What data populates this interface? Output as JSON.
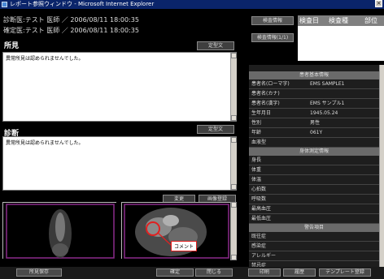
{
  "window": {
    "title": "レポート参照ウィンドウ - Microsoft Internet Explorer"
  },
  "left": {
    "line_top": "診断医:テスト 医師 ／ 2006/08/11 18:00:35",
    "diagnosis_doctor": "診断医:テスト 医師 ／ 2006/08/11 18:00:35",
    "confirm_doctor": "確定医:テスト 医師 ／ 2006/08/11 18:00:35",
    "findings_label": "所見",
    "findings_btn": "定型文",
    "findings_text": "異常所見は認められませんでした。",
    "diagnosis_label": "診断",
    "diagnosis_btn": "定型文",
    "diagnosis_text": "異常所見は認められませんでした。",
    "btn_edit": "変更",
    "btn_image_register": "画像登録",
    "annotation": "コメント"
  },
  "right": {
    "exam_info_btn": "検査情報",
    "exam_info_btn2": "検査情報(1/1)",
    "col_date": "検査日",
    "col_type": "検査種",
    "col_part": "部位",
    "patient_header": "患者基本情報",
    "patient_rows": [
      {
        "label": "患者名(ローマ字)",
        "value": "EMS SAMPLE1"
      },
      {
        "label": "患者名(カナ)",
        "value": ""
      },
      {
        "label": "患者名(漢字)",
        "value": "EMS サンプル1"
      },
      {
        "label": "生年月日",
        "value": "1945.05.24"
      },
      {
        "label": "性別",
        "value": "男性"
      },
      {
        "label": "年齢",
        "value": "061Y"
      },
      {
        "label": "血液型",
        "value": ""
      }
    ],
    "body_header": "身体測定情報",
    "body_rows": [
      "身長",
      "体重",
      "体温",
      "心拍数",
      "呼吸数",
      "最高血圧",
      "最低血圧"
    ],
    "caution_header": "警告項目",
    "caution_rows": [
      "既往症",
      "感染症",
      "アレルギー",
      "禁忌症",
      "特記事項"
    ]
  },
  "footer": {
    "btn_save": "所見保存",
    "btn_confirm": "確定",
    "btn_close": "閉じる",
    "btn_print": "印刷",
    "btn_history": "履歴",
    "btn_template": "テンプレート登録"
  }
}
